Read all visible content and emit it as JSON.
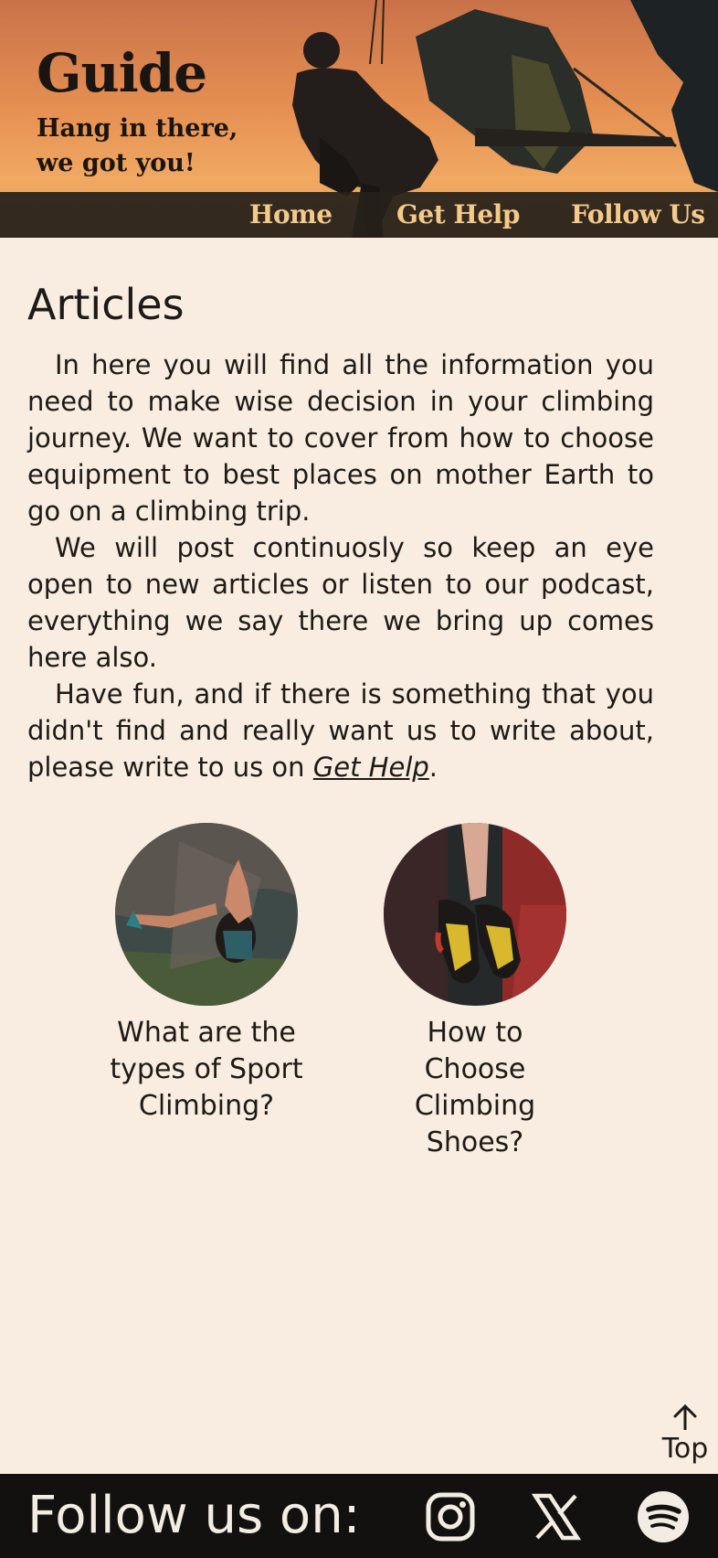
{
  "header": {
    "title": "Guide",
    "subtitle": "Hang in there, we got you!"
  },
  "nav": {
    "items": [
      "Home",
      "Get Help",
      "Follow Us"
    ]
  },
  "main": {
    "title": "Articles",
    "paragraphs": {
      "p1": "In here you will find all the information you need to make wise decision in your climbing journey. We want to cover from how to choose equipment to best places on mother Earth to go on a climbing trip.",
      "p2": "We will post continuosly so keep an eye open to new articles or listen to our podcast, everything we say there we bring up comes here also.",
      "p3_before": "Have fun, and if there is something that you didn't find and really want us to write about, please write to us on ",
      "p3_link": "Get Help",
      "p3_after": "."
    },
    "cards": [
      {
        "caption": "What are the types of Sport Climbing?"
      },
      {
        "caption": "How to Choose Climbing Shoes?"
      }
    ]
  },
  "top_link": {
    "label": "Top"
  },
  "footer": {
    "text": "Follow us on:",
    "icons": [
      "instagram-icon",
      "x-icon",
      "spotify-icon"
    ]
  },
  "colors": {
    "background": "#f8ede0",
    "nav_text": "#f4c98a",
    "footer_bg": "#121110"
  }
}
